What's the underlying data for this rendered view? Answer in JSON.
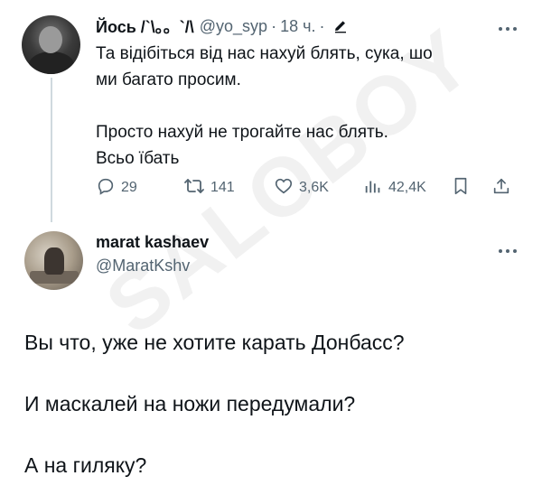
{
  "tweet1": {
    "author_name": "Йось /`\\。。`/\\",
    "handle": "@yo_syp",
    "separator": "·",
    "time": "18 ч.",
    "lines": [
      "Та відібіться від нас нахуй блять, сука, шо",
      "ми багато просим.",
      "",
      "Просто нахуй не трогайте нас блять.",
      "Всьо їбать"
    ],
    "actions": {
      "replies": "29",
      "reposts": "141",
      "likes": "3,6K",
      "views": "42,4K"
    }
  },
  "tweet2": {
    "author_name": "marat kashaev",
    "handle": "@MaratKshv",
    "lines": [
      "Вы что, уже не хотите карать Донбасс?",
      "",
      "И маскалей на ножи передумали?",
      "",
      "А на гиляку?"
    ]
  },
  "watermark": "SALOBOY",
  "icons": [
    "edit-icon",
    "more-icon",
    "reply-icon",
    "repost-icon",
    "like-icon",
    "views-icon",
    "bookmark-icon",
    "share-icon"
  ],
  "colors": {
    "text": "#0f1419",
    "secondary": "#536471",
    "thread_line": "#cfd9de"
  }
}
